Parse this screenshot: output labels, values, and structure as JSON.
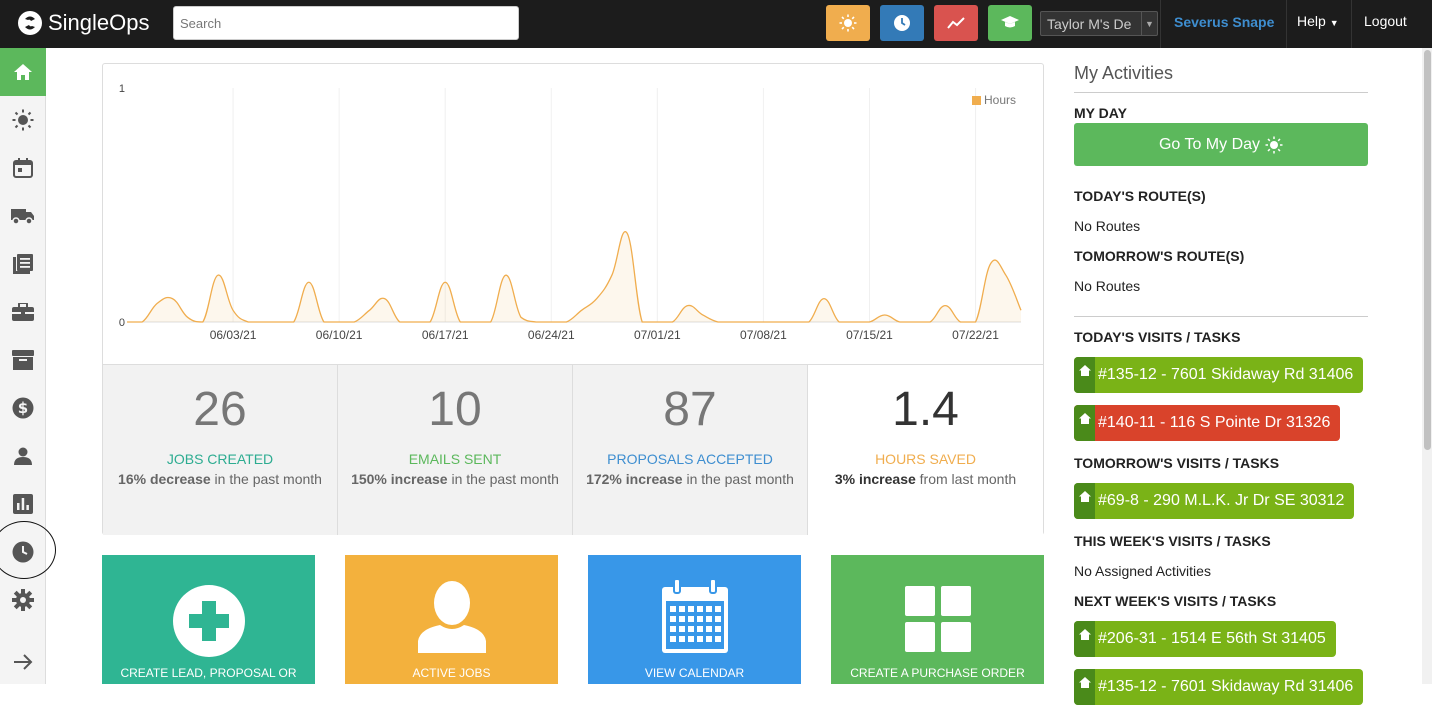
{
  "app": {
    "brand": "SingleOps"
  },
  "search": {
    "placeholder": "Search"
  },
  "quick_buttons": [
    {
      "name": "my-day-button",
      "color": "#f0ad4e",
      "icon": "sun-icon"
    },
    {
      "name": "time-clock-button",
      "color": "#337ab7",
      "icon": "clock-icon"
    },
    {
      "name": "reports-button",
      "color": "#d9534f",
      "icon": "trend-icon"
    },
    {
      "name": "training-button",
      "color": "#5cb85c",
      "icon": "graduation-cap-icon"
    }
  ],
  "account_select": {
    "value": "Taylor M's De"
  },
  "user": {
    "name": "Severus Snape"
  },
  "nav": {
    "help": "Help",
    "logout": "Logout"
  },
  "sidebar": [
    {
      "icon": "home-icon",
      "active": true
    },
    {
      "icon": "sun-icon"
    },
    {
      "icon": "calendar-icon"
    },
    {
      "icon": "truck-icon"
    },
    {
      "icon": "documents-icon"
    },
    {
      "icon": "briefcase-icon"
    },
    {
      "icon": "archive-icon"
    },
    {
      "icon": "dollar-icon"
    },
    {
      "icon": "person-icon"
    },
    {
      "icon": "bar-chart-icon"
    },
    {
      "icon": "clock-icon"
    },
    {
      "icon": "gear-icon"
    },
    {
      "icon": "arrow-right-icon"
    }
  ],
  "chart_data": {
    "type": "area",
    "series": [
      {
        "name": "Hours",
        "color": "#f0ad4e"
      }
    ],
    "x": [
      "05/27/21",
      "05/28/21",
      "05/29/21",
      "05/30/21",
      "05/31/21",
      "06/01/21",
      "06/02/21",
      "06/03/21",
      "06/04/21",
      "06/05/21",
      "06/06/21",
      "06/07/21",
      "06/08/21",
      "06/09/21",
      "06/10/21",
      "06/11/21",
      "06/12/21",
      "06/13/21",
      "06/14/21",
      "06/15/21",
      "06/16/21",
      "06/17/21",
      "06/18/21",
      "06/19/21",
      "06/20/21",
      "06/21/21",
      "06/22/21",
      "06/23/21",
      "06/24/21",
      "06/25/21",
      "06/26/21",
      "06/27/21",
      "06/28/21",
      "06/29/21",
      "06/30/21",
      "07/01/21",
      "07/02/21",
      "07/03/21",
      "07/04/21",
      "07/05/21",
      "07/06/21",
      "07/07/21",
      "07/08/21",
      "07/09/21",
      "07/10/21",
      "07/11/21",
      "07/12/21",
      "07/13/21",
      "07/14/21",
      "07/15/21",
      "07/16/21",
      "07/17/21",
      "07/18/21",
      "07/19/21",
      "07/20/21",
      "07/21/21",
      "07/22/21",
      "07/23/21"
    ],
    "values": [
      0,
      0,
      0.08,
      0.1,
      0.02,
      0,
      0.2,
      0.05,
      0,
      0,
      0,
      0,
      0.17,
      0,
      0,
      0,
      0.05,
      0.1,
      0,
      0,
      0,
      0.17,
      0,
      0,
      0,
      0.2,
      0.02,
      0,
      0,
      0,
      0.05,
      0.1,
      0.2,
      0.38,
      0,
      0,
      0,
      0.07,
      0.03,
      0,
      0,
      0,
      0,
      0,
      0,
      0,
      0.1,
      0,
      0,
      0,
      0.03,
      0,
      0,
      0,
      0.07,
      0,
      0,
      0.25,
      0.2,
      0.05
    ],
    "xticks": [
      "06/03/21",
      "06/10/21",
      "06/17/21",
      "06/24/21",
      "07/01/21",
      "07/08/21",
      "07/15/21",
      "07/22/21"
    ],
    "ylim": [
      0,
      1
    ],
    "yticks": [
      "0",
      "1"
    ],
    "legend": "top-right"
  },
  "stats": [
    {
      "value": "26",
      "label": "JOBS CREATED",
      "color": "#2dac91",
      "pct": "16% decrease",
      "rest": " in the past month"
    },
    {
      "value": "10",
      "label": "EMAILS SENT",
      "color": "#5cb85c",
      "pct": "150% increase",
      "rest": " in the past month"
    },
    {
      "value": "87",
      "label": "PROPOSALS ACCEPTED",
      "color": "#3e8ed0",
      "pct": "172% increase",
      "rest": " in the past month"
    },
    {
      "value": "1.4",
      "label": "HOURS SAVED",
      "color": "#f0ad4e",
      "pct": "3% increase",
      "rest": " from last month"
    }
  ],
  "tiles": [
    {
      "label": "CREATE LEAD, PROPOSAL OR",
      "color": "#2fb593",
      "icon": "plus-circle-icon"
    },
    {
      "label": "ACTIVE JOBS",
      "color": "#f3b13d",
      "icon": "person-icon"
    },
    {
      "label": "VIEW CALENDAR",
      "color": "#3897e8",
      "icon": "calendar-icon"
    },
    {
      "label": "CREATE A PURCHASE ORDER",
      "color": "#5cb85c",
      "icon": "grid-icon"
    }
  ],
  "activities": {
    "title": "My Activities",
    "my_day": "MY DAY",
    "go_button": "Go To My Day",
    "todays_routes": "TODAY'S ROUTE(S)",
    "todays_routes_empty": "No Routes",
    "tomorrows_routes": "TOMORROW'S ROUTE(S)",
    "tomorrows_routes_empty": "No Routes",
    "todays_visits": "TODAY'S VISITS / TASKS",
    "todays_visit_items": [
      {
        "label": "#135-12 - 7601 Skidaway Rd 31406",
        "status": "green"
      },
      {
        "label": "#140-11 - 116 S Pointe Dr 31326",
        "status": "red"
      }
    ],
    "tomorrows_visits": "TOMORROW'S VISITS / TASKS",
    "tomorrows_visit_items": [
      {
        "label": "#69-8 - 290 M.L.K. Jr Dr SE 30312",
        "status": "green"
      }
    ],
    "this_week": "THIS WEEK'S VISITS / TASKS",
    "this_week_empty": "No Assigned Activities",
    "next_week": "NEXT WEEK'S VISITS / TASKS",
    "next_week_items": [
      {
        "label": "#206-31 - 1514 E 56th St 31405",
        "status": "green"
      },
      {
        "label": "#135-12 - 7601 Skidaway Rd 31406",
        "status": "green"
      }
    ]
  }
}
